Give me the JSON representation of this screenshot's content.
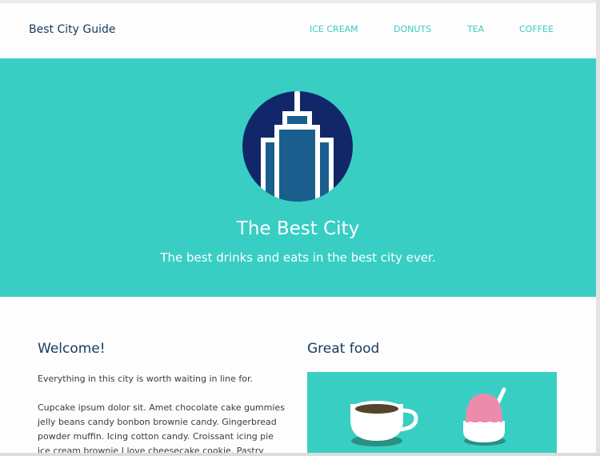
{
  "header": {
    "brand": "Best City Guide",
    "nav": [
      "ICE CREAM",
      "DONUTS",
      "TEA",
      "COFFEE"
    ]
  },
  "hero": {
    "title": "The Best City",
    "subtitle": "The best drinks and eats in the best city ever."
  },
  "welcome": {
    "title": "Welcome!",
    "intro": "Everything in this city is worth waiting in line for.",
    "body": "Cupcake ipsum dolor sit. Amet chocolate cake gummies jelly beans candy bonbon brownie candy. Gingerbread powder muffin. Icing cotton candy. Croissant icing pie ice cream brownie I love cheesecake cookie. Pastry chocolate"
  },
  "food": {
    "title": "Great food",
    "icons": [
      "coffee-cup-icon",
      "ice-cream-icon"
    ]
  },
  "colors": {
    "accent": "#38cec3",
    "navy": "#163b5c",
    "logo_bg": "#12276a",
    "building": "#1a5e8e"
  }
}
